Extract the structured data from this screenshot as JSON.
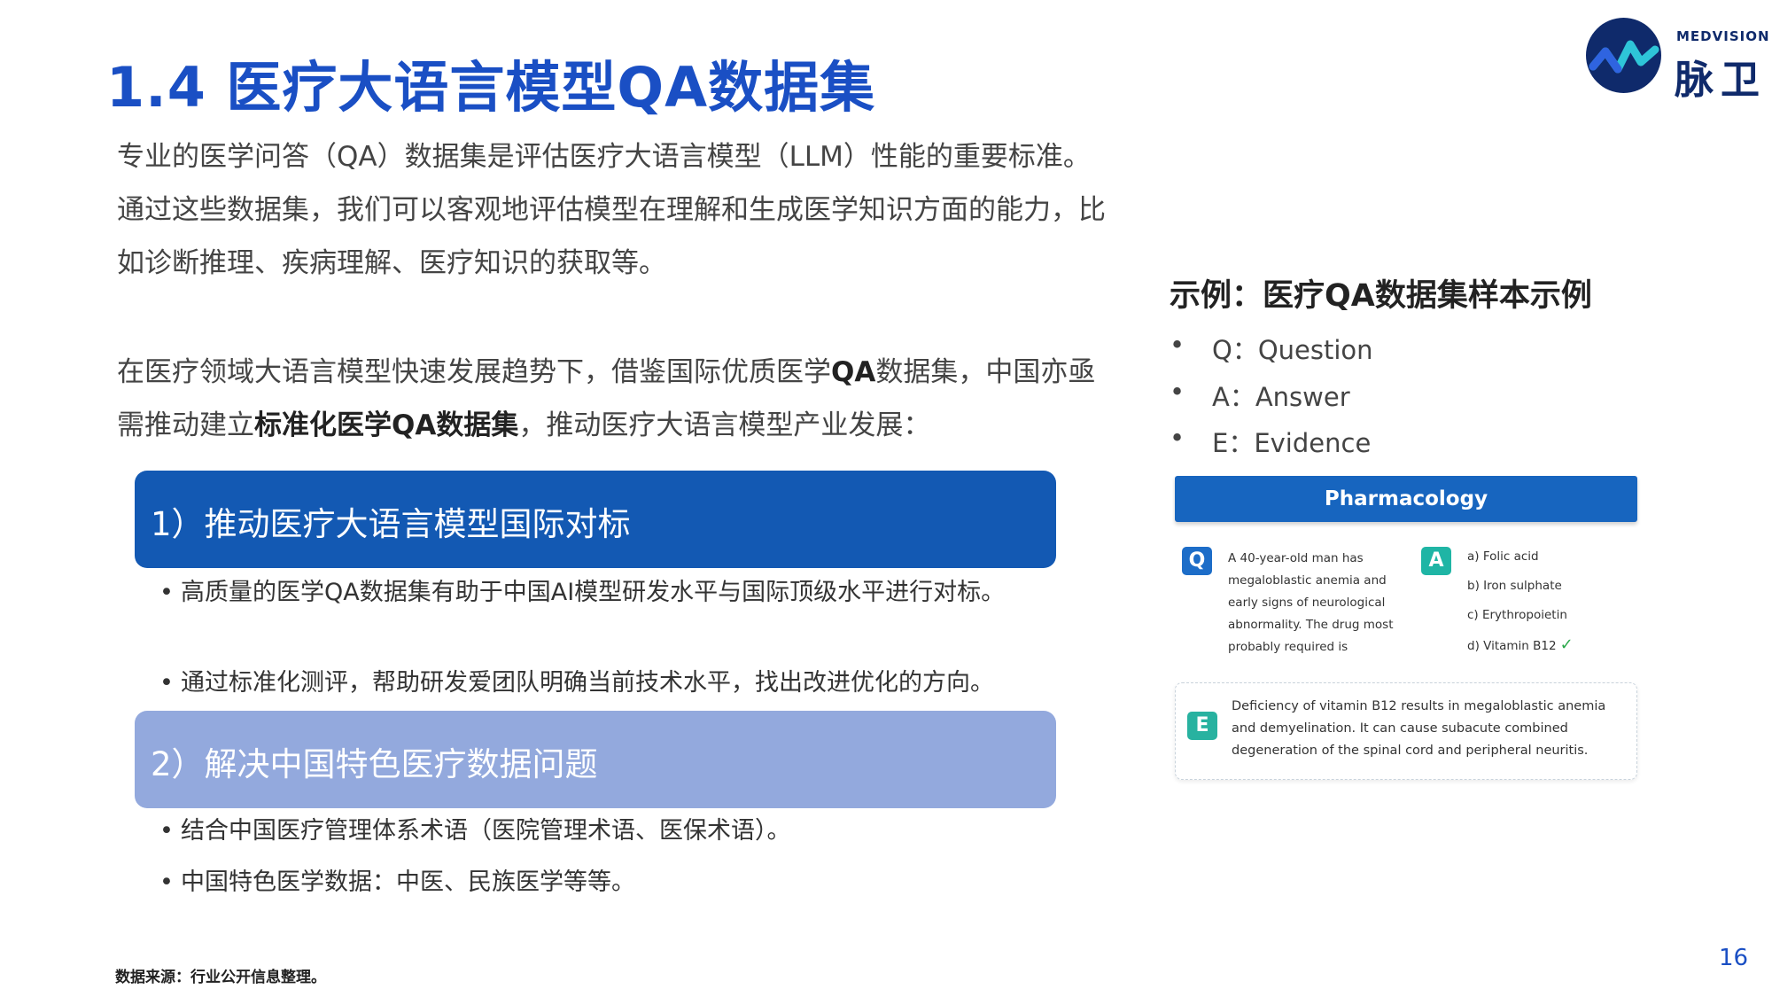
{
  "title": "1.4 医疗大语言模型QA数据集",
  "logo": {
    "en": "MEDVISION",
    "zh": "脉卫",
    "colors": {
      "circle": "#0f2a6b",
      "wave": "#2ec5d8"
    }
  },
  "intro": {
    "p1": "专业的医学问答（QA）数据集是评估医疗大语言模型（LLM）性能的重要标准。通过这些数据集，我们可以客观地评估模型在理解和生成医学知识方面的能力，比如诊断推理、疾病理解、医疗知识的获取等。",
    "p2_a": "在医疗领域大语言模型快速发展趋势下，借鉴国际优质医学",
    "p2_b": "QA",
    "p2_c": "数据集，中国亦亟需推动建立",
    "p2_d": "标准化医学QA数据集",
    "p2_e": "，推动医疗大语言模型产业发展："
  },
  "sections": [
    {
      "heading": "1）推动医疗大语言模型国际对标",
      "color": "#1359b3",
      "bullets": [
        "高质量的医学QA数据集有助于中国AI模型研发水平与国际顶级水平进行对标。",
        "通过标准化测评，帮助研发爱团队明确当前技术水平，找出改进优化的方向。"
      ]
    },
    {
      "heading": "2）解决中国特色医疗数据问题",
      "color": "#93a9dd",
      "bullets": [
        "结合中国医疗管理体系术语（医院管理术语、医保术语）。",
        "中国特色医学数据：中医、民族医学等等。"
      ]
    }
  ],
  "example": {
    "title": "示例：医疗QA数据集样本示例",
    "legend": [
      {
        "dot": "•",
        "text": "Q：Question"
      },
      {
        "dot": "•",
        "text": "A：Answer"
      },
      {
        "dot": "•",
        "text": "E：Evidence"
      }
    ],
    "category": "Pharmacology",
    "q_tag": "Q",
    "question": "A 40-year-old man has megaloblastic anemia and early signs of neurological abnormality. The drug most probably required is",
    "a_tag": "A",
    "answers": [
      "a) Folic acid",
      "b) Iron sulphate",
      "c) Erythropoietin",
      "d) Vitamin B12"
    ],
    "check": "✓",
    "e_tag": "E",
    "evidence": "Deficiency of vitamin B12 results in megaloblastic anemia and demyelination. It can cause subacute combined degeneration of the spinal cord and peripheral neuritis."
  },
  "source": "数据来源：行业公开信息整理。",
  "page_number": "16",
  "bullet_char": "•"
}
